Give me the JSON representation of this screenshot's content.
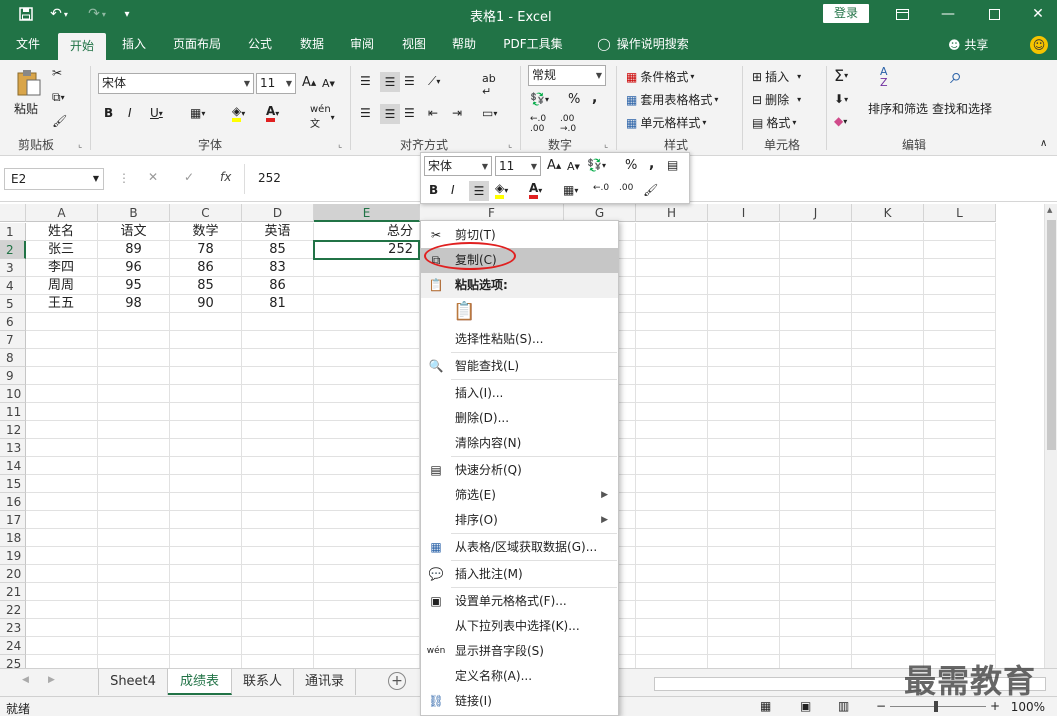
{
  "titlebar": {
    "title": "表格1  -  Excel",
    "login": "登录"
  },
  "tabs": [
    "文件",
    "开始",
    "插入",
    "页面布局",
    "公式",
    "数据",
    "审阅",
    "视图",
    "帮助",
    "PDF工具集",
    "操作说明搜索"
  ],
  "share": "共享",
  "ribbon": {
    "clipboard": {
      "paste": "粘贴",
      "label": "剪贴板"
    },
    "font": {
      "name": "宋体",
      "size": "11",
      "label": "字体"
    },
    "alignment": {
      "label": "对齐方式"
    },
    "number": {
      "format": "常规",
      "percent": "%",
      "comma": ",",
      "label": "数字"
    },
    "styles": {
      "conditional": "条件格式",
      "table": "套用表格格式",
      "cell": "单元格样式",
      "label": "样式"
    },
    "cells": {
      "insert": "插入",
      "delete": "删除",
      "format": "格式",
      "label": "单元格"
    },
    "editing": {
      "sort": "排序和筛选",
      "find": "查找和选择",
      "label": "编辑"
    }
  },
  "formula_bar": {
    "name_box": "E2",
    "fx": "fx",
    "value": "252"
  },
  "columns": [
    "A",
    "B",
    "C",
    "D",
    "E",
    "F",
    "G",
    "H",
    "I",
    "J",
    "K",
    "L"
  ],
  "rows": [
    "1",
    "2",
    "3",
    "4",
    "5",
    "6",
    "7",
    "8",
    "9",
    "10",
    "11",
    "12",
    "13",
    "14",
    "15",
    "16",
    "17",
    "18",
    "19",
    "20",
    "21",
    "22",
    "23",
    "24",
    "25"
  ],
  "table": {
    "headers": [
      "姓名",
      "语文",
      "数学",
      "英语",
      "总分"
    ],
    "data": [
      [
        "张三",
        "89",
        "78",
        "85",
        "252"
      ],
      [
        "李四",
        "96",
        "86",
        "83",
        ""
      ],
      [
        "周周",
        "95",
        "85",
        "86",
        ""
      ],
      [
        "王五",
        "98",
        "90",
        "81",
        ""
      ]
    ]
  },
  "mini_toolbar": {
    "font": "宋体",
    "size": "11"
  },
  "context_menu": [
    {
      "label": "剪切(T)",
      "icon": "scissors-icon"
    },
    {
      "label": "复制(C)",
      "icon": "copy-icon"
    },
    {
      "label": "粘贴选项:",
      "icon": "paste-icon"
    },
    {
      "label": "选择性粘贴(S)...",
      "icon": ""
    },
    {
      "label": "智能查找(L)",
      "icon": "smart-lookup-icon"
    },
    {
      "label": "插入(I)...",
      "icon": ""
    },
    {
      "label": "删除(D)...",
      "icon": ""
    },
    {
      "label": "清除内容(N)",
      "icon": ""
    },
    {
      "label": "快速分析(Q)",
      "icon": "quick-analysis-icon"
    },
    {
      "label": "筛选(E)",
      "icon": ""
    },
    {
      "label": "排序(O)",
      "icon": ""
    },
    {
      "label": "从表格/区域获取数据(G)...",
      "icon": "table-icon"
    },
    {
      "label": "插入批注(M)",
      "icon": "comment-icon"
    },
    {
      "label": "设置单元格格式(F)...",
      "icon": "format-cells-icon"
    },
    {
      "label": "从下拉列表中选择(K)...",
      "icon": ""
    },
    {
      "label": "显示拼音字段(S)",
      "icon": "phonetic-icon"
    },
    {
      "label": "定义名称(A)...",
      "icon": ""
    },
    {
      "label": "链接(I)",
      "icon": "link-icon"
    }
  ],
  "sheets": [
    "Sheet4",
    "成绩表",
    "联系人",
    "通讯录"
  ],
  "active_sheet": "成绩表",
  "status": {
    "text": "就绪",
    "zoom": "100%"
  },
  "watermark": "最需教育",
  "colors": {
    "accent": "#217346",
    "highlight": "#e02020"
  }
}
